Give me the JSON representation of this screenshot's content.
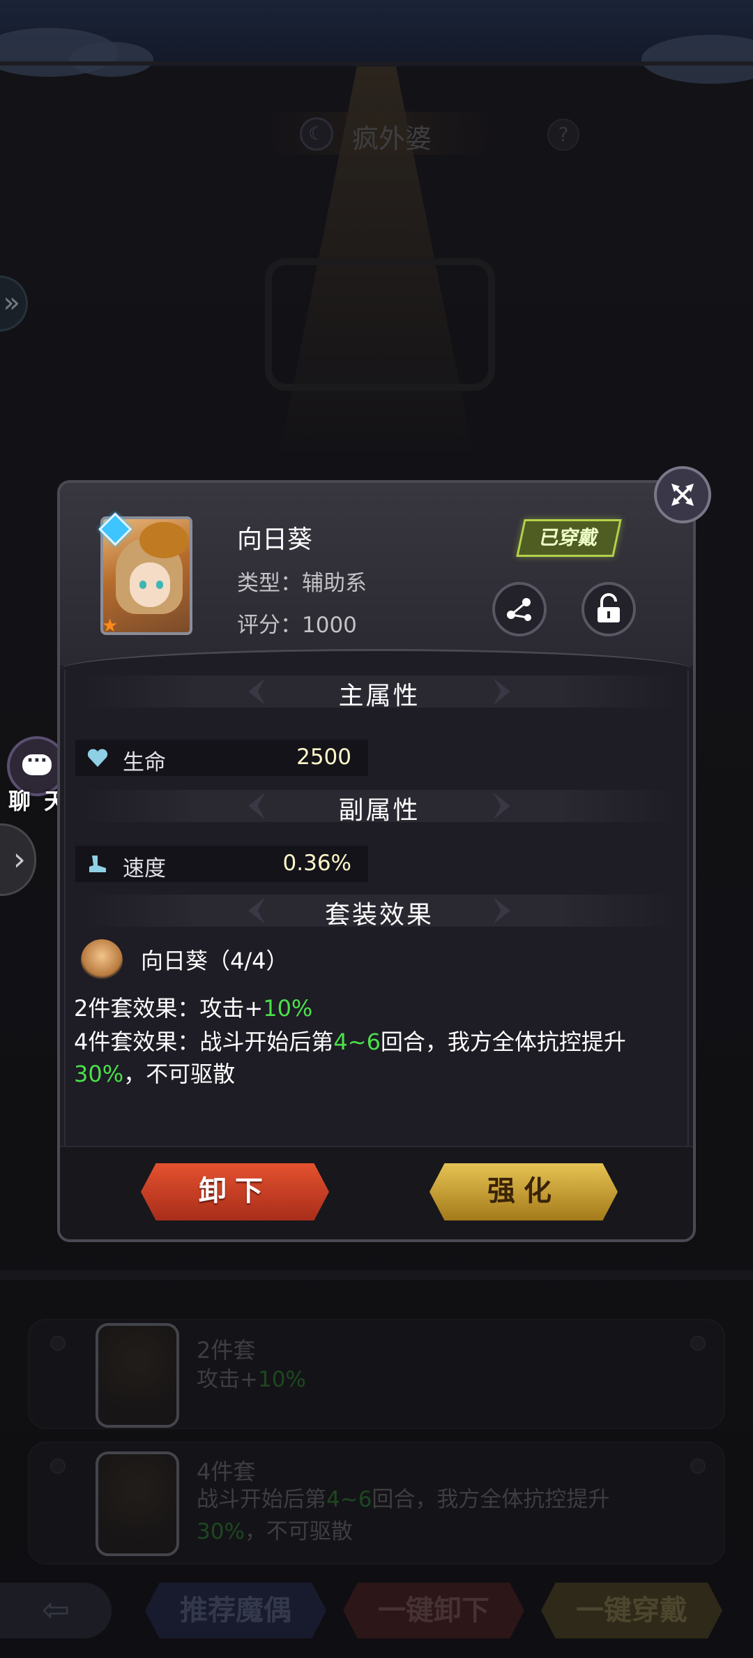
{
  "background": {
    "title": "疯外婆",
    "help_icon": "question-icon",
    "set_cards": [
      {
        "title": "2件套",
        "desc_prefix": "攻击+",
        "desc_value": "10%"
      },
      {
        "title": "4件套",
        "desc_line1_a": "战斗开始后第",
        "desc_line1_b": "4~6",
        "desc_line1_c": "回合，我方全体抗控提升",
        "desc_line2_a": "30%",
        "desc_line2_b": "，不可驱散"
      }
    ],
    "bottom_buttons": [
      "推荐魔偶",
      "一键卸下",
      "一键穿戴"
    ]
  },
  "side": {
    "chat_label": "聊 天"
  },
  "modal": {
    "item_name": "向日葵",
    "type_label": "类型",
    "type_value": "辅助系",
    "score_label": "评分",
    "score_value": "1000",
    "type_line": "类型：辅助系",
    "score_line": "评分：1000",
    "equipped_badge": "已穿戴",
    "main_attr_title": "主属性",
    "main_attr": {
      "name": "生命",
      "value": "2500",
      "icon": "heart-icon"
    },
    "sub_attr_title": "副属性",
    "sub_attr": {
      "name": "速度",
      "value": "0.36%",
      "icon": "boot-icon"
    },
    "set_title": "套装效果",
    "set_name": "向日葵（4/4）",
    "set2_label": "2件套效果",
    "set2_text": "：攻击+",
    "set2_value": "10%",
    "set4_label": "4件套效果",
    "set4_a": "：战斗开始后第",
    "set4_b": "4~6",
    "set4_c": "回合，我方全体抗控提升",
    "set4_d": "30%",
    "set4_e": "，不可驱散",
    "btn_unequip": "卸下",
    "btn_enhance": "强化",
    "colors": {
      "highlight_green": "#4be04b",
      "equipped": "#b4d24a",
      "unequip": "#d8462a",
      "enhance": "#d7b13f"
    }
  }
}
